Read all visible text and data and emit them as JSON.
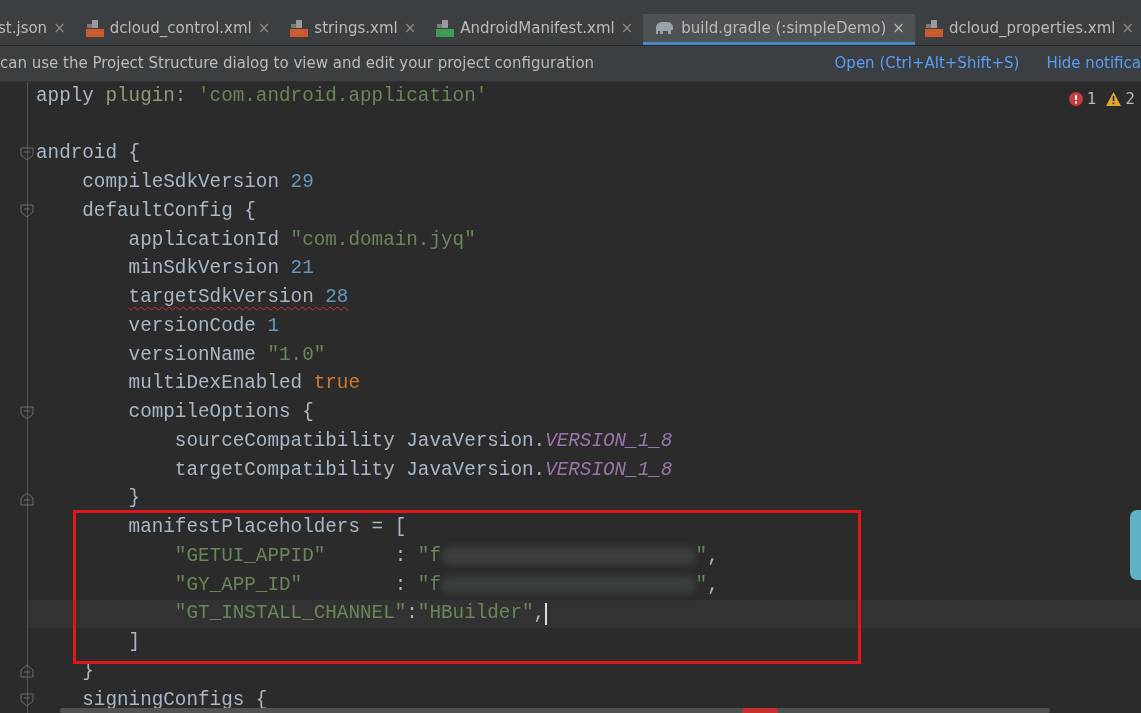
{
  "tabs": [
    {
      "label": "st.json",
      "kind": "plain",
      "selected": false,
      "close": "×"
    },
    {
      "label": "dcloud_control.xml",
      "kind": "xml",
      "selected": false,
      "close": "×"
    },
    {
      "label": "strings.xml",
      "kind": "xml",
      "selected": false,
      "close": "×"
    },
    {
      "label": "AndroidManifest.xml",
      "kind": "manifest",
      "selected": false,
      "close": "×"
    },
    {
      "label": "build.gradle (:simpleDemo)",
      "kind": "gradle",
      "selected": true,
      "close": "×"
    },
    {
      "label": "dcloud_properties.xml",
      "kind": "xml",
      "selected": false,
      "close": "×"
    }
  ],
  "notification": {
    "message": "can use the Project Structure dialog to view and edit your project configuration",
    "links": [
      "Open (Ctrl+Alt+Shift+S)",
      "Hide notifica"
    ]
  },
  "inspections": {
    "errors": "1",
    "warnings": "2"
  },
  "lines": [
    {
      "kind": "code",
      "tokens": [
        {
          "kind": "plain",
          "text": "apply "
        },
        {
          "kind": "named_arg",
          "text": "plugin: "
        },
        {
          "kind": "string",
          "text": "'com.android.application'"
        }
      ]
    },
    {
      "kind": "blank"
    },
    {
      "kind": "code",
      "fold_start": true,
      "tokens": [
        {
          "kind": "plain",
          "text": "android {"
        }
      ]
    },
    {
      "kind": "code",
      "tokens": [
        {
          "kind": "plain",
          "text": "    compileSdkVersion "
        },
        {
          "kind": "number",
          "text": "29"
        }
      ]
    },
    {
      "kind": "code",
      "fold_start": true,
      "tokens": [
        {
          "kind": "plain",
          "text": "    defaultConfig {"
        }
      ]
    },
    {
      "kind": "code",
      "tokens": [
        {
          "kind": "plain",
          "text": "        applicationId "
        },
        {
          "kind": "string",
          "text": "\"com.domain.jyq\""
        }
      ]
    },
    {
      "kind": "code",
      "tokens": [
        {
          "kind": "plain",
          "text": "        minSdkVersion "
        },
        {
          "kind": "number",
          "text": "21"
        }
      ]
    },
    {
      "kind": "code",
      "warning": true,
      "tokens": [
        {
          "kind": "plain",
          "text": "        targetSdkVersion "
        },
        {
          "kind": "number",
          "text": "28"
        }
      ]
    },
    {
      "kind": "code",
      "tokens": [
        {
          "kind": "plain",
          "text": "        versionCode "
        },
        {
          "kind": "number",
          "text": "1"
        }
      ]
    },
    {
      "kind": "code",
      "tokens": [
        {
          "kind": "plain",
          "text": "        versionName "
        },
        {
          "kind": "string",
          "text": "\"1.0\""
        }
      ]
    },
    {
      "kind": "code",
      "tokens": [
        {
          "kind": "plain",
          "text": "        multiDexEnabled "
        },
        {
          "kind": "keyword",
          "text": "true"
        }
      ]
    },
    {
      "kind": "code",
      "fold_start": true,
      "tokens": [
        {
          "kind": "plain",
          "text": "        compileOptions {"
        }
      ]
    },
    {
      "kind": "code",
      "tokens": [
        {
          "kind": "plain",
          "text": "            sourceCompatibility JavaVersion."
        },
        {
          "kind": "constant",
          "text": "VERSION_1_8"
        }
      ]
    },
    {
      "kind": "code",
      "tokens": [
        {
          "kind": "plain",
          "text": "            targetCompatibility JavaVersion."
        },
        {
          "kind": "constant",
          "text": "VERSION_1_8"
        }
      ]
    },
    {
      "kind": "code",
      "fold_end": true,
      "tokens": [
        {
          "kind": "plain",
          "text": "        }"
        }
      ]
    },
    {
      "kind": "code",
      "tokens": [
        {
          "kind": "plain",
          "text": "        manifestPlaceholders = ["
        }
      ]
    },
    {
      "kind": "code",
      "tokens": [
        {
          "kind": "string",
          "text": "            \"GETUI_APPID\""
        },
        {
          "kind": "plain",
          "text": "      : "
        },
        {
          "kind": "string",
          "text": "\"f"
        },
        {
          "kind": "redacted"
        },
        {
          "kind": "string",
          "text": "\""
        },
        {
          "kind": "plain",
          "text": ","
        }
      ]
    },
    {
      "kind": "code",
      "tokens": [
        {
          "kind": "string",
          "text": "            \"GY_APP_ID\""
        },
        {
          "kind": "plain",
          "text": "        : "
        },
        {
          "kind": "string",
          "text": "\"f"
        },
        {
          "kind": "redacted"
        },
        {
          "kind": "string",
          "text": "\""
        },
        {
          "kind": "plain",
          "text": ","
        }
      ]
    },
    {
      "kind": "code",
      "current": true,
      "tokens": [
        {
          "kind": "string",
          "text": "            \"GT_INSTALL_CHANNEL\""
        },
        {
          "kind": "plain",
          "text": ":"
        },
        {
          "kind": "string",
          "text": "\"HBuilder\""
        },
        {
          "kind": "plain",
          "text": ","
        }
      ]
    },
    {
      "kind": "code",
      "tokens": [
        {
          "kind": "plain",
          "text": "        ]"
        }
      ]
    },
    {
      "kind": "code",
      "fold_end": true,
      "tokens": [
        {
          "kind": "plain",
          "text": "    }"
        }
      ]
    },
    {
      "kind": "code",
      "fold_start": true,
      "tokens": [
        {
          "kind": "plain",
          "text": "    signingConfigs {"
        }
      ]
    }
  ]
}
